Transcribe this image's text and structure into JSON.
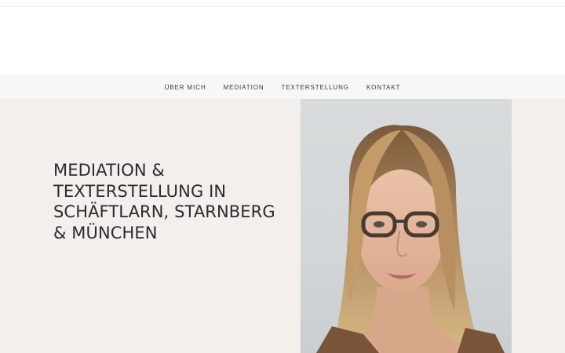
{
  "nav": {
    "items": [
      {
        "label": "ÜBER MICH"
      },
      {
        "label": "MEDIATION"
      },
      {
        "label": "TEXTERSTELLUNG"
      },
      {
        "label": "KONTAKT"
      }
    ]
  },
  "hero": {
    "title": "MEDIATION & TEXTERSTELLUNG IN SCHÄFTLARN, STARNBERG & MÜNCHEN",
    "image": {
      "icon": "portrait-photo"
    }
  },
  "colors": {
    "nav_bg": "#f7f7f7",
    "hero_bg": "#f3efec",
    "text": "#2b2b2b"
  }
}
